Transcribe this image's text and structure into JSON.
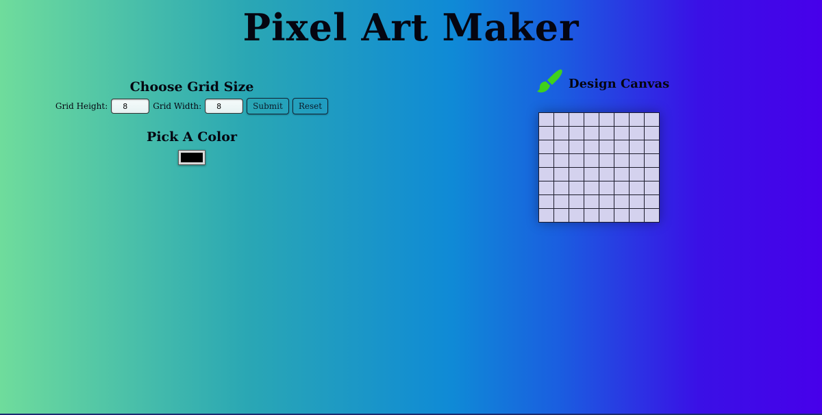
{
  "title": "Pixel Art Maker",
  "grid_size": {
    "heading": "Choose Grid Size",
    "height_label": "Grid Height:",
    "height_value": "8",
    "width_label": "Grid Width:",
    "width_value": "8",
    "submit_label": "Submit",
    "reset_label": "Reset"
  },
  "color": {
    "heading": "Pick A Color",
    "value": "#000000"
  },
  "canvas": {
    "title": "Design Canvas",
    "icon": "paintbrush-icon",
    "rows": 8,
    "cols": 8,
    "cell_color": "#d4d2ee"
  }
}
